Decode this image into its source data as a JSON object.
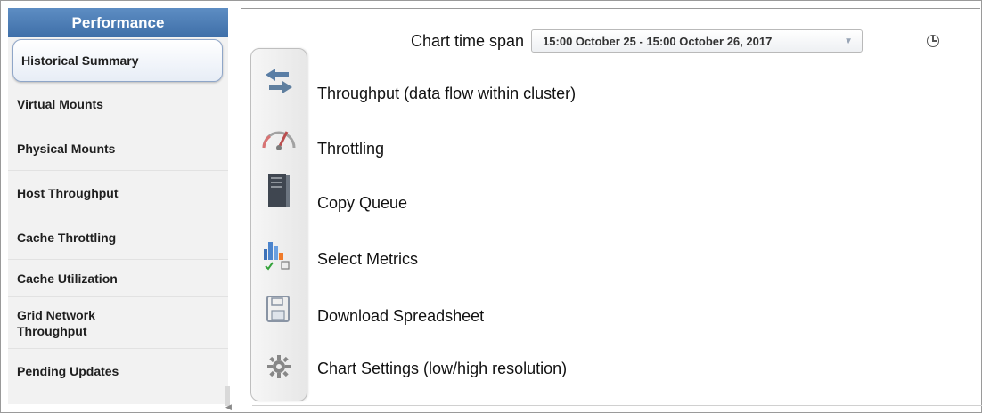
{
  "sidebar": {
    "title": "Performance",
    "items": [
      {
        "label": "Historical Summary",
        "active": true
      },
      {
        "label": "Virtual Mounts"
      },
      {
        "label": "Physical Mounts"
      },
      {
        "label": "Host Throughput"
      },
      {
        "label": "Cache Throttling"
      },
      {
        "label": "Cache Utilization"
      },
      {
        "label": "Grid Network Throughput"
      },
      {
        "label": "Pending Updates"
      }
    ]
  },
  "chart": {
    "time_span_label": "Chart time span",
    "time_span_value": "15:00 October 25 - 15:00 October 26, 2017"
  },
  "features": [
    {
      "label": "Throughput (data flow within cluster)",
      "icon": "arrows-icon"
    },
    {
      "label": "Throttling",
      "icon": "gauge-icon"
    },
    {
      "label": "Copy Queue",
      "icon": "queue-icon"
    },
    {
      "label": "Select Metrics",
      "icon": "metrics-icon"
    },
    {
      "label": "Download Spreadsheet",
      "icon": "save-icon"
    },
    {
      "label": "Chart Settings (low/high resolution)",
      "icon": "gear-icon"
    }
  ],
  "colors": {
    "header_blue": "#4f80bb",
    "active_border": "#8fa6c8",
    "accent_green": "#35a33b",
    "bar_blue": "#3c71b8",
    "bar_orange": "#f07b2a"
  }
}
